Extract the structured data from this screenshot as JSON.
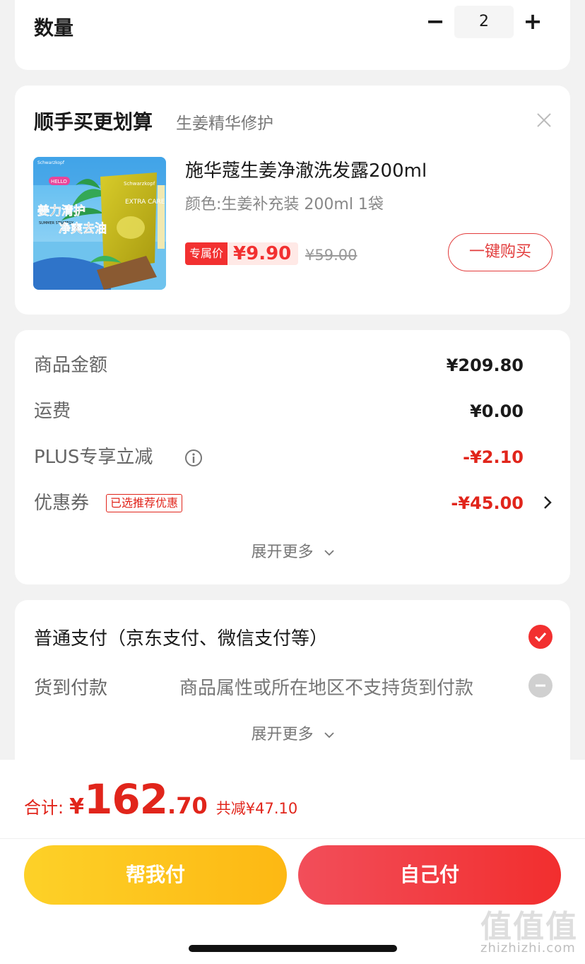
{
  "quantity": {
    "label": "数量",
    "minus": "−",
    "value": "2",
    "plus": "+"
  },
  "upsell": {
    "title": "顺手买更划算",
    "subtitle": "生姜精华修护",
    "product": {
      "name": "施华蔻生姜净澈洗发露200ml",
      "spec": "颜色:生姜补充装 200ml 1袋",
      "image_text": {
        "brand": "Schwarzkopf",
        "line1": "姜力清护",
        "line2": "净爽去油",
        "hello": "HELLO",
        "summer": "SUMMER STRATEGY",
        "extra_care": "EXTRA CARE"
      },
      "price_badge": "专属价",
      "price": "¥9.90",
      "original_price": "¥59.00",
      "buy_button": "一键购买"
    }
  },
  "summary": {
    "goods_label": "商品金额",
    "goods_value": "¥209.80",
    "shipping_label": "运费",
    "shipping_value": "¥0.00",
    "plus_label": "PLUS专享立减",
    "plus_value": "-¥2.10",
    "coupon_label": "优惠券",
    "coupon_tag": "已选推荐优惠",
    "coupon_value": "-¥45.00",
    "expand": "展开更多"
  },
  "payment": {
    "normal_label": "普通支付（京东支付、微信支付等）",
    "cod_label": "货到付款",
    "cod_note": "商品属性或所在地区不支持货到付款",
    "expand": "展开更多"
  },
  "bottom": {
    "total_label": "合计:",
    "currency": "¥",
    "total_int": "162",
    "total_dec": ".70",
    "saved": "共减¥47.10",
    "help_pay": "帮我付",
    "self_pay": "自己付"
  },
  "watermark": {
    "logo": "值值值",
    "text": "zhizhizhi.com"
  },
  "colors": {
    "accent_red": "#e1251b",
    "button_red": "#f23030",
    "button_yellow": "#fdc21c"
  }
}
